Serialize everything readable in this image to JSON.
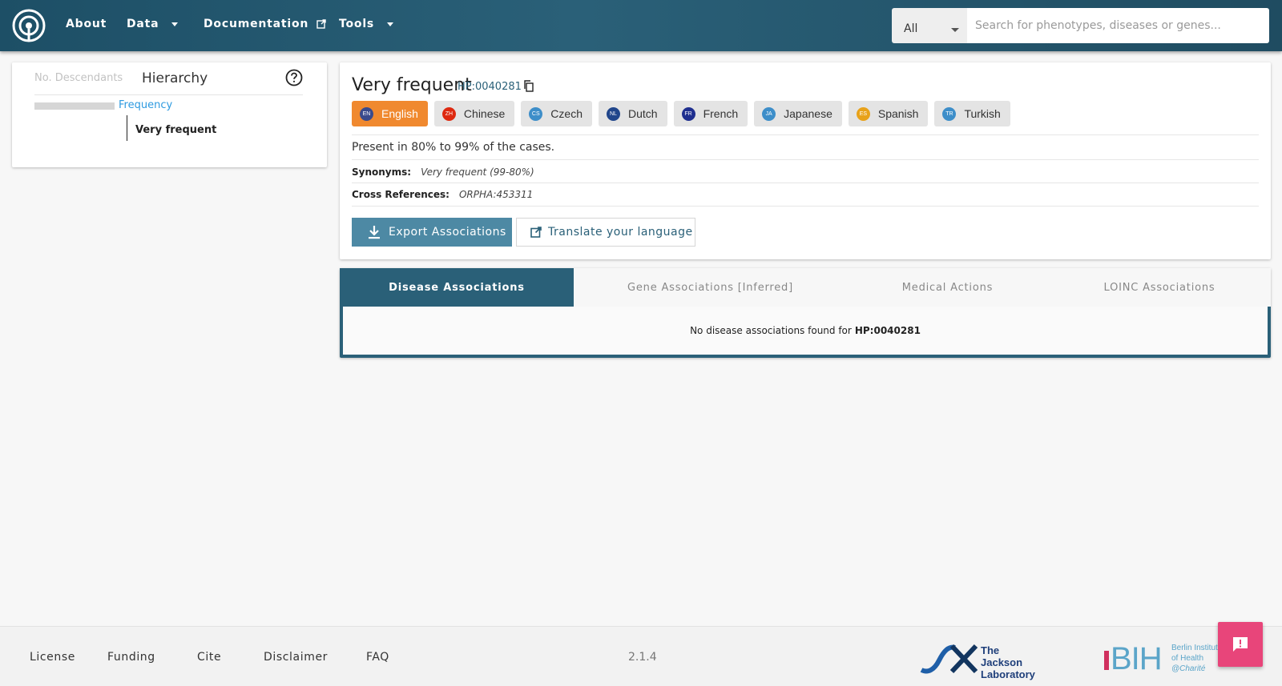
{
  "header": {
    "nav": [
      {
        "label": "About"
      },
      {
        "label": "Data"
      },
      {
        "label": "Documentation"
      },
      {
        "label": "Tools"
      }
    ],
    "search": {
      "category": "All",
      "placeholder": "Search for phenotypes, diseases or genes..."
    }
  },
  "hierarchy": {
    "tab_descendants": "No. Descendants",
    "tab_hierarchy": "Hierarchy",
    "parent": "Frequency",
    "current": "Very frequent"
  },
  "term": {
    "name": "Very frequent",
    "id": "HP:0040281",
    "languages": [
      {
        "code": "EN",
        "label": "English",
        "color": "#3a4a8c"
      },
      {
        "code": "ZH",
        "label": "Chinese",
        "color": "#de2910"
      },
      {
        "code": "CS",
        "label": "Czech",
        "color": "#3d8ec9"
      },
      {
        "code": "NL",
        "label": "Dutch",
        "color": "#21468b"
      },
      {
        "code": "FR",
        "label": "French",
        "color": "#1f2f8f"
      },
      {
        "code": "JA",
        "label": "Japanese",
        "color": "#3d8ec9"
      },
      {
        "code": "ES",
        "label": "Spanish",
        "color": "#e8a21a"
      },
      {
        "code": "TR",
        "label": "Turkish",
        "color": "#3d8ec9"
      }
    ],
    "definition": "Present in 80% to 99% of the cases.",
    "synonyms_label": "Synonyms:",
    "synonyms": "Very frequent (99-80%)",
    "xrefs_label": "Cross References:",
    "xrefs": "ORPHA:453311",
    "export_label": "Export Associations",
    "translate_label": "Translate your language"
  },
  "associations": {
    "tabs": [
      "Disease Associations",
      "Gene Associations [Inferred]",
      "Medical Actions",
      "LOINC Associations"
    ],
    "empty_text": "No disease associations found for",
    "empty_id": "HP:0040281"
  },
  "footer": {
    "links": [
      "License",
      "Funding",
      "Cite",
      "Disclaimer",
      "FAQ"
    ],
    "version": "2.1.4",
    "jax_line1": "The Jackson",
    "jax_line2": "Laboratory",
    "bih_mark": "BIH",
    "bih_line1": "Berlin Institute",
    "bih_line2": "of Health",
    "bih_line3": "@Charité"
  },
  "colors": {
    "header": "#2a6078",
    "accent_orange": "#f0892f",
    "feedback_pink": "#e8457a"
  }
}
